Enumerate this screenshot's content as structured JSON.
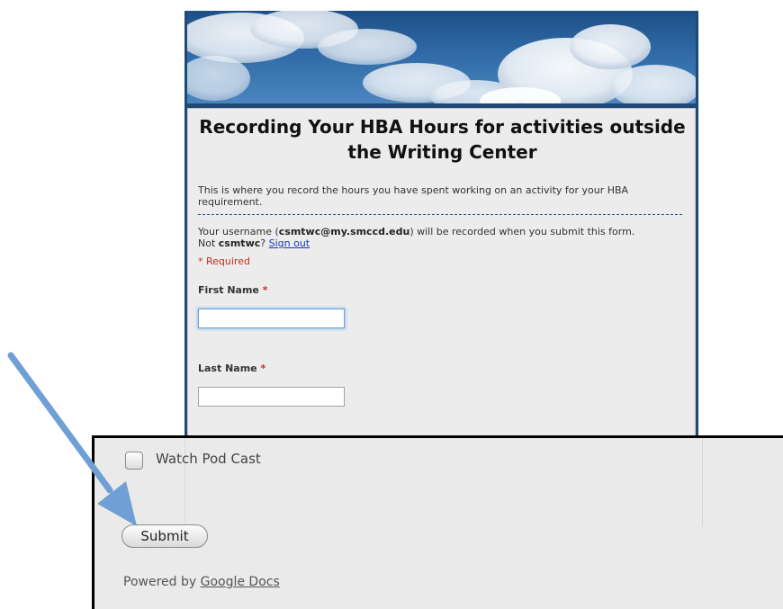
{
  "form": {
    "title": "Recording Your HBA Hours for activities outside the Writing Center",
    "description": "This is where you record the hours you have spent working on an activity for your HBA requirement.",
    "user_prefix": "Your username (",
    "username": "csmtwc@my.smccd.edu",
    "user_suffix": ") will be recorded when you submit this form.",
    "not_prefix": "Not ",
    "short_user": "csmtwc",
    "not_suffix": "? ",
    "sign_out": "Sign out",
    "required_note": "* Required",
    "fields": [
      {
        "label": "First Name",
        "required_mark": "*",
        "value": ""
      },
      {
        "label": "Last Name",
        "required_mark": "*",
        "value": ""
      }
    ]
  },
  "zoom": {
    "checkbox_label": "Watch Pod Cast",
    "checkbox_checked": false,
    "submit_label": "Submit",
    "powered_prefix": "Powered by ",
    "powered_link": "Google Docs"
  },
  "colors": {
    "frame": "#1f4a78",
    "required": "#c2311d",
    "link": "#1a37c4",
    "arrow": "#6f9fd4"
  },
  "icons": {
    "banner": "sky-clouds-image",
    "arrow": "arrow-annotation"
  }
}
